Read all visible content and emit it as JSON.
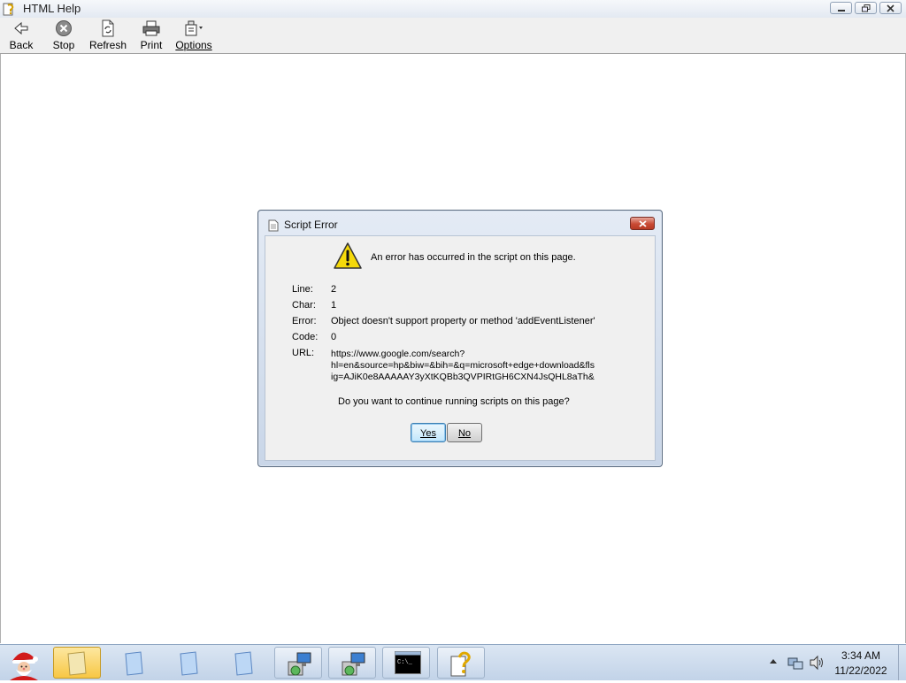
{
  "window": {
    "title": "HTML Help",
    "controls": {
      "minimize": "minimize",
      "maximize": "restore",
      "close": "close"
    }
  },
  "toolbar": {
    "buttons": [
      {
        "label": "Back",
        "icon": "back-arrow-icon"
      },
      {
        "label": "Stop",
        "icon": "stop-icon"
      },
      {
        "label": "Refresh",
        "icon": "refresh-icon"
      },
      {
        "label": "Print",
        "icon": "printer-icon"
      },
      {
        "label": "Options",
        "icon": "options-icon"
      }
    ]
  },
  "dialog": {
    "title": "Script Error",
    "message": "An error has occurred in the script on this page.",
    "fields": [
      {
        "label": "Line:",
        "value": "2"
      },
      {
        "label": "Char:",
        "value": "1"
      },
      {
        "label": "Error:",
        "value": "Object doesn't support property or method 'addEventListener'"
      },
      {
        "label": "Code:",
        "value": "0"
      },
      {
        "label": "URL:",
        "value_lines": [
          "https://www.google.com/search?",
          "hl=en&source=hp&biw=&bih=&q=microsoft+edge+download&fls",
          "ig=AJiK0e8AAAAAY3yXtKQBb3QVPIRtGH6CXN4JsQHL8aTh&"
        ]
      }
    ],
    "question": "Do you want to continue running scripts on this page?",
    "yes_label": "Yes",
    "no_label": "No"
  },
  "taskbar": {
    "items": [
      {
        "name": "folder",
        "state": "active"
      },
      {
        "name": "blank-window-1",
        "state": "normal"
      },
      {
        "name": "blank-window-2",
        "state": "normal"
      },
      {
        "name": "blank-window-3",
        "state": "normal"
      },
      {
        "name": "network-setup-1",
        "state": "pinned"
      },
      {
        "name": "network-setup-2",
        "state": "pinned"
      },
      {
        "name": "command-prompt",
        "state": "pinned"
      },
      {
        "name": "html-help",
        "state": "pinned"
      }
    ],
    "clock": {
      "time": "3:34 AM",
      "date": "11/22/2022"
    }
  }
}
